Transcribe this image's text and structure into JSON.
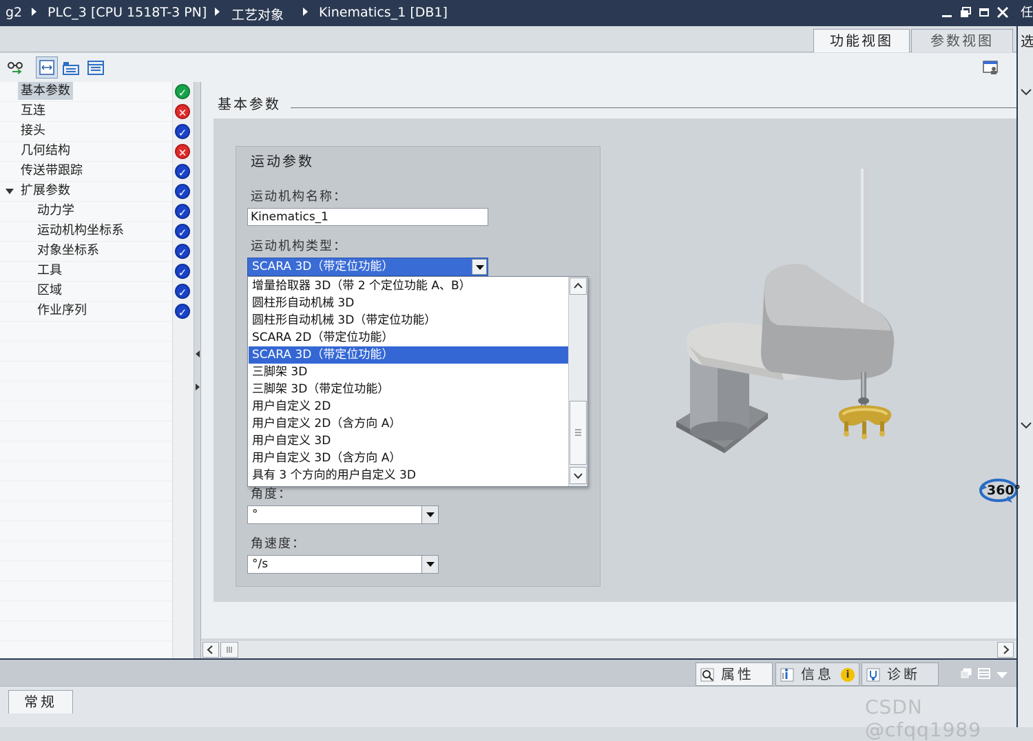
{
  "titlebar": {
    "crumbs": [
      "g2",
      "PLC_3 [CPU 1518T-3 PN]",
      "工艺对象",
      "Kinematics_1 [DB1]"
    ]
  },
  "right_strip": {
    "top_char": "任",
    "mid_char": "选"
  },
  "view_tabs": {
    "function_view": "功能视图",
    "parameter_view": "参数视图"
  },
  "nav": {
    "items": [
      {
        "label": "基本参数",
        "status": "ok"
      },
      {
        "label": "互连",
        "status": "error"
      },
      {
        "label": "接头",
        "status": "check"
      },
      {
        "label": "几何结构",
        "status": "error"
      },
      {
        "label": "传送带跟踪",
        "status": "check"
      },
      {
        "label": "扩展参数",
        "status": "check"
      },
      {
        "label": "动力学",
        "status": "check"
      },
      {
        "label": "运动机构坐标系",
        "status": "check"
      },
      {
        "label": "对象坐标系",
        "status": "check"
      },
      {
        "label": "工具",
        "status": "check"
      },
      {
        "label": "区域",
        "status": "check"
      },
      {
        "label": "作业序列",
        "status": "check"
      }
    ]
  },
  "main": {
    "section_title": "基本参数",
    "motion_box": {
      "title": "运动参数",
      "name_label": "运动机构名称：",
      "name_value": "Kinematics_1",
      "type_label": "运动机构类型：",
      "type_value": "SCARA 3D（带定位功能）",
      "angle_label": "角度：",
      "angle_value": "°",
      "angular_velocity_label": "角速度：",
      "angular_velocity_value": "°/s"
    },
    "type_options": [
      "增量拾取器 3D（带 2 个定位功能 A、B）",
      "圆柱形自动机械 3D",
      "圆柱形自动机械 3D（带定位功能）",
      "SCARA 2D（带定位功能）",
      "SCARA 3D（带定位功能）",
      "三脚架 3D",
      "三脚架 3D（带定位功能）",
      "用户自定义 2D",
      "用户自定义 2D（含方向 A）",
      "用户自定义 3D",
      "用户自定义 3D（含方向 A）",
      "具有 3 个方向的用户自定义 3D"
    ],
    "selected_option_index": 4,
    "rotate_label": "360°"
  },
  "inspector": {
    "properties_tab": "属性",
    "info_tab": "信息",
    "diagnostics_tab": "诊断",
    "general_tab": "常规"
  },
  "watermark": "CSDN @cfqq1989",
  "colors": {
    "titlebar_bg": "#2b3a52",
    "selection_blue": "#3467d4",
    "status_ok": "#17a34a",
    "status_error": "#e02b2b",
    "status_check": "#1a43c8"
  }
}
